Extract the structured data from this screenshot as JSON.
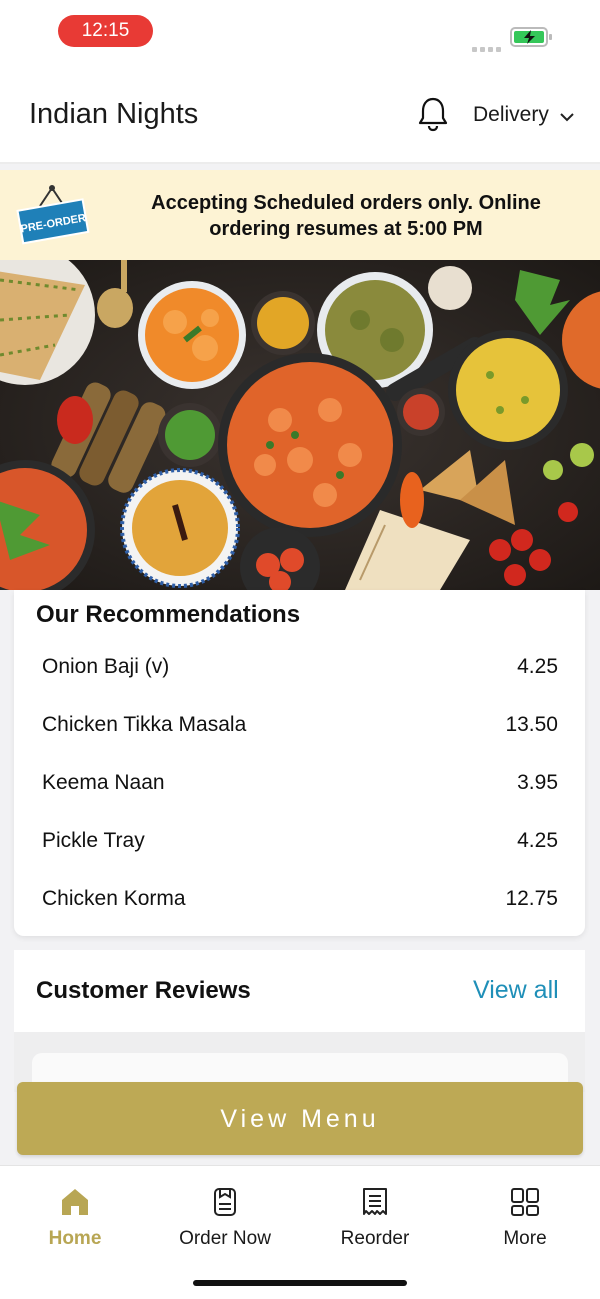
{
  "status_bar": {
    "time": "12:15"
  },
  "header": {
    "title": "Indian Nights",
    "order_mode": "Delivery"
  },
  "banner": {
    "badge": "PRE-ORDER",
    "message": "Accepting Scheduled orders only. Online ordering resumes at 5:00 PM"
  },
  "recommendations": {
    "title": "Our Recommendations",
    "items": [
      {
        "name": "Onion Baji (v)",
        "price": "4.25"
      },
      {
        "name": "Chicken Tikka Masala",
        "price": "13.50"
      },
      {
        "name": "Keema Naan",
        "price": "3.95"
      },
      {
        "name": "Pickle Tray",
        "price": "4.25"
      },
      {
        "name": "Chicken Korma",
        "price": "12.75"
      }
    ]
  },
  "reviews": {
    "title": "Customer Reviews",
    "view_all": "View all"
  },
  "cta": {
    "view_menu": "View Menu"
  },
  "tabs": [
    {
      "label": "Home",
      "icon": "home-icon",
      "active": true
    },
    {
      "label": "Order Now",
      "icon": "order-icon",
      "active": false
    },
    {
      "label": "Reorder",
      "icon": "receipt-icon",
      "active": false
    },
    {
      "label": "More",
      "icon": "grid-icon",
      "active": false
    }
  ],
  "colors": {
    "accent": "#bda955",
    "link": "#1f8fb8",
    "banner_bg": "#fdf3d4",
    "status_pill": "#e83a35"
  }
}
